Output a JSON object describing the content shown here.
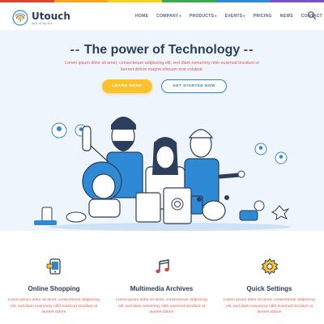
{
  "colors": {
    "stripe": [
      "#e5402b",
      "#f7a51c",
      "#f4d21b",
      "#3aaa4a",
      "#2f8ad6",
      "#7b4fc7"
    ],
    "brand_dark": "#2b3e5c",
    "accent_yellow": "#fcc22b",
    "accent_blue": "#2f7fd6",
    "text_red": "#e05b53"
  },
  "header": {
    "logo_name": "Utouch",
    "logo_tagline": "app template",
    "logo_icon": "fingerprint-icon",
    "nav": [
      {
        "label": "HOME",
        "has_dropdown": false
      },
      {
        "label": "COMPANY",
        "has_dropdown": true
      },
      {
        "label": "PRODUCTS",
        "has_dropdown": true
      },
      {
        "label": "EVENTS",
        "has_dropdown": true
      },
      {
        "label": "PRICING",
        "has_dropdown": false
      },
      {
        "label": "NEWS",
        "has_dropdown": false
      },
      {
        "label": "CONTACT",
        "has_dropdown": false
      }
    ],
    "dropdown_caret": "▾",
    "search_icon": "search-icon"
  },
  "hero": {
    "dash_left": "--",
    "dash_right": "--",
    "title": "The power of Technology",
    "description": "Lorem ipsum dolor sit amet, consectetuer adipiscing elit, sed diam nonummy nibh euismod tincidunt ut laoreet dolore magna aliquam erat volutpat.",
    "primary_button": "LEARN MORE",
    "secondary_button": "GET STARTED NOW",
    "illustration_icon": "team-illustration"
  },
  "features": [
    {
      "icon": "phone-shopping-icon",
      "title": "Online Shopping",
      "text": "Lorem ipsum dolor sit amet, consectetuer adipiscing elit, sed diam nonummy nibh euismod tincidunt ut laoreet dolore"
    },
    {
      "icon": "music-note-icon",
      "title": "Multimedia Archives",
      "text": "Lorem ipsum dolor sit amet, consectetuer adipiscing elit, sed diam nonummy nibh euismod tincidunt ut laoreet dolore"
    },
    {
      "icon": "gear-icon",
      "title": "Quick Settings",
      "text": "Lorem ipsum dolor sit amet, consectetuer adipiscing elit, sed diam nonummy nibh euismod tincidunt ut laoreet dolore"
    }
  ]
}
